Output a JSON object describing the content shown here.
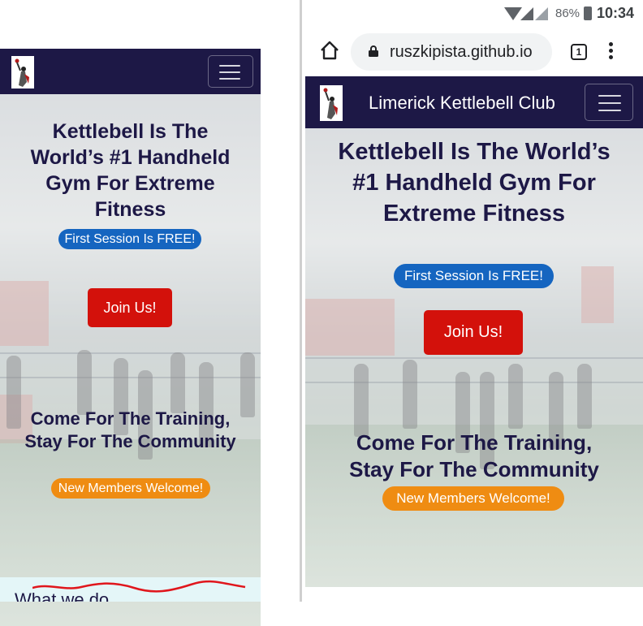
{
  "left_preview": {
    "hero": {
      "title": "Kettlebell Is The World’s #1 Handheld Gym For Extreme Fitness",
      "badge": "First Session Is FREE!",
      "cta": "Join Us!",
      "subtitle": "Come For The Training, Stay For The Community",
      "badge2": "New Members Welcome!"
    },
    "section_heading": "What we do"
  },
  "right_phone": {
    "status_bar": {
      "battery": "86%",
      "time": "10:34"
    },
    "browser": {
      "url": "ruszkipista.github.io",
      "tab_count": "1"
    },
    "navbar": {
      "brand": "Limerick Kettlebell Club"
    },
    "hero": {
      "title": "Kettlebell Is The World’s #1 Handheld Gym For Extreme Fitness",
      "badge": "First Session Is FREE!",
      "cta": "Join Us!",
      "subtitle": "Come For The Training, Stay For The Community",
      "badge2": "New Members Welcome!"
    }
  },
  "colors": {
    "navbar": "#1d1846",
    "heading": "#1d1846",
    "badge_blue": "#1565c0",
    "badge_orange": "#ef8c12",
    "cta_red": "#d3110b"
  },
  "icons": {
    "logo": "kettlebell-lifter-logo-icon",
    "menu": "hamburger-menu-icon",
    "home": "home-icon",
    "lock": "lock-icon",
    "tabs": "tab-switcher-icon",
    "more": "more-vert-icon"
  }
}
